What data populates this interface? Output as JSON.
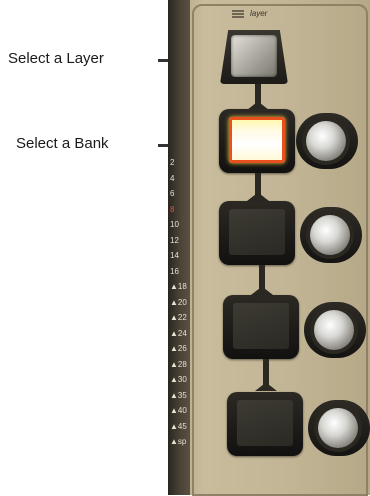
{
  "callouts": {
    "layer": "Select a Layer",
    "bank": "Select a Bank"
  },
  "panel": {
    "layer_label": "layer",
    "meter_scale": [
      "2",
      "4",
      "6",
      "8",
      "10",
      "12",
      "14",
      "16",
      "18",
      "20",
      "22",
      "24",
      "26",
      "28",
      "30",
      "35",
      "40",
      "45",
      "sp"
    ]
  },
  "banks": [
    {
      "name": "bank-1",
      "active": true
    },
    {
      "name": "bank-2",
      "active": false
    },
    {
      "name": "bank-3",
      "active": false
    },
    {
      "name": "bank-4",
      "active": false
    }
  ],
  "colors": {
    "panel": "#c2b595",
    "active_screen": "#fff6a0",
    "active_border": "#e8501e",
    "meter_red": "#d9544a"
  }
}
